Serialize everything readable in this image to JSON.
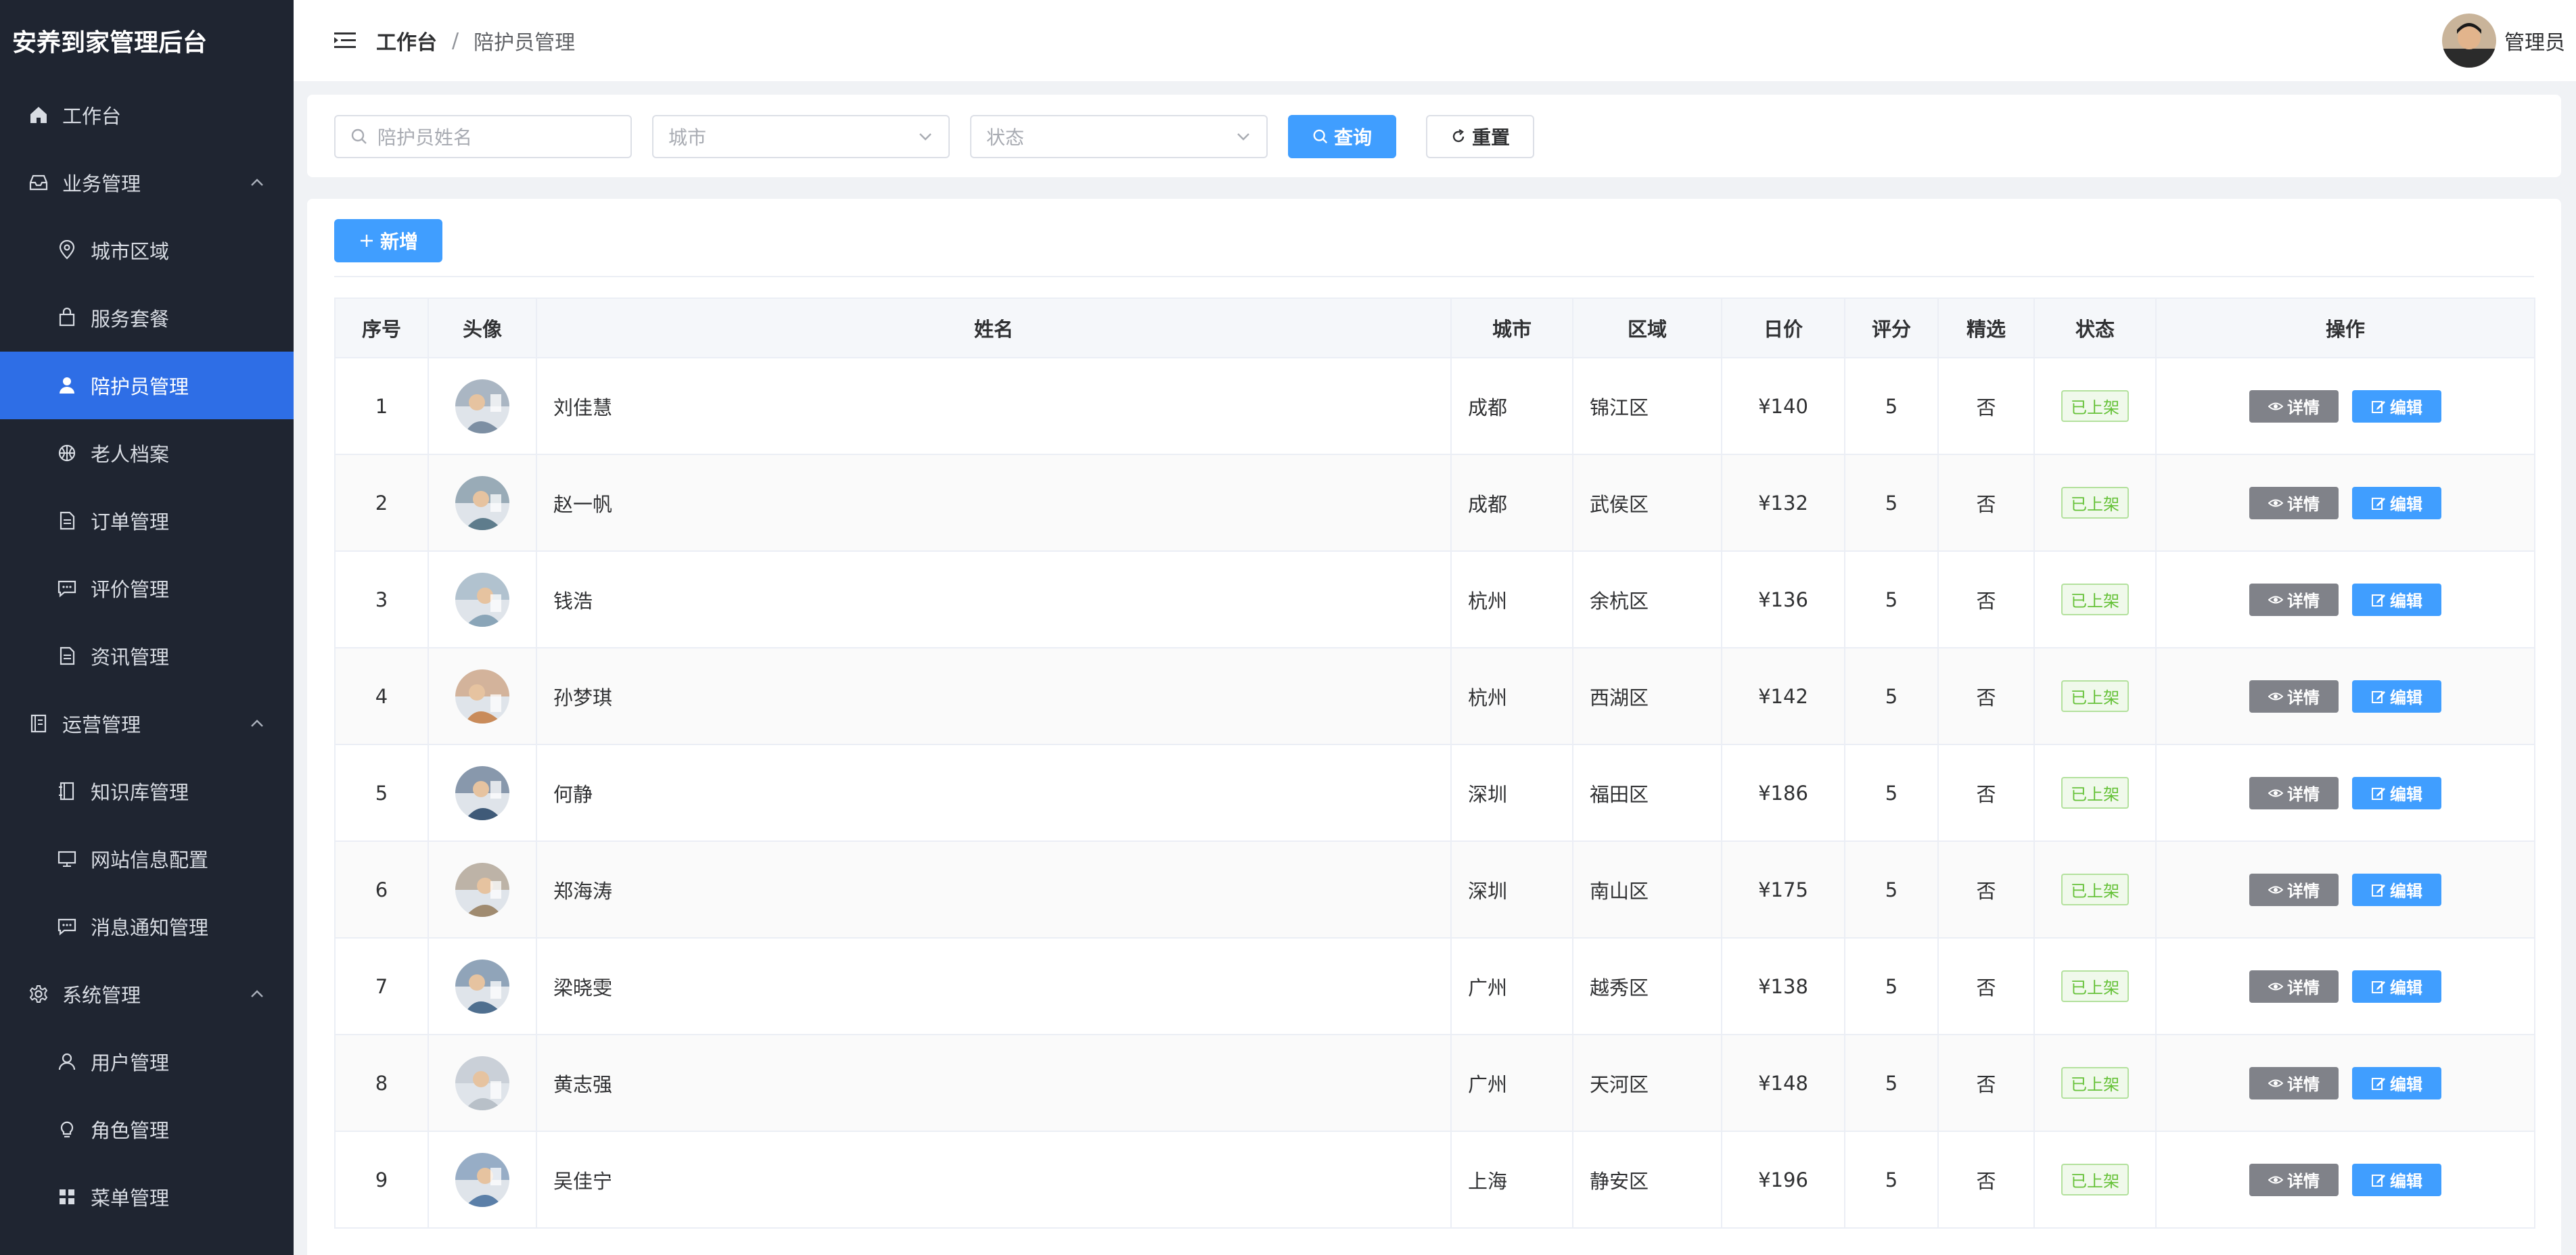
{
  "brand": "安养到家管理后台",
  "sidebar": {
    "items": [
      {
        "label": "工作台",
        "icon": "home-icon",
        "level": "top"
      },
      {
        "label": "业务管理",
        "icon": "inbox-icon",
        "level": "top",
        "expanded": true
      },
      {
        "label": "城市区域",
        "icon": "location-icon",
        "level": "sub"
      },
      {
        "label": "服务套餐",
        "icon": "bag-icon",
        "level": "sub"
      },
      {
        "label": "陪护员管理",
        "icon": "user-icon",
        "level": "sub",
        "active": true
      },
      {
        "label": "老人档案",
        "icon": "basketball-icon",
        "level": "sub"
      },
      {
        "label": "订单管理",
        "icon": "document-icon",
        "level": "sub"
      },
      {
        "label": "评价管理",
        "icon": "chat-icon",
        "level": "sub"
      },
      {
        "label": "资讯管理",
        "icon": "document-icon",
        "level": "sub"
      },
      {
        "label": "运营管理",
        "icon": "tickets-icon",
        "level": "top",
        "expanded": true
      },
      {
        "label": "知识库管理",
        "icon": "notebook-icon",
        "level": "sub"
      },
      {
        "label": "网站信息配置",
        "icon": "monitor-icon",
        "level": "sub"
      },
      {
        "label": "消息通知管理",
        "icon": "chat-icon",
        "level": "sub"
      },
      {
        "label": "系统管理",
        "icon": "gear-icon",
        "level": "top",
        "expanded": true
      },
      {
        "label": "用户管理",
        "icon": "user-outline-icon",
        "level": "sub"
      },
      {
        "label": "角色管理",
        "icon": "bulb-icon",
        "level": "sub"
      },
      {
        "label": "菜单管理",
        "icon": "grid-icon",
        "level": "sub"
      }
    ]
  },
  "header": {
    "breadcrumb_root": "工作台",
    "breadcrumb_separator": "/",
    "breadcrumb_current": "陪护员管理",
    "user_name": "管理员"
  },
  "filter": {
    "name_placeholder": "陪护员姓名",
    "city_placeholder": "城市",
    "status_placeholder": "状态",
    "search_label": "查询",
    "reset_label": "重置"
  },
  "toolbar": {
    "add_label": "新增"
  },
  "table": {
    "headers": [
      "序号",
      "头像",
      "姓名",
      "城市",
      "区域",
      "日价",
      "评分",
      "精选",
      "状态",
      "操作"
    ],
    "detail_label": "详情",
    "edit_label": "编辑",
    "rows": [
      {
        "no": "1",
        "name": "刘佳慧",
        "city": "成都",
        "district": "锦江区",
        "price": "¥140",
        "rating": "5",
        "featured": "否",
        "status": "已上架"
      },
      {
        "no": "2",
        "name": "赵一帆",
        "city": "成都",
        "district": "武侯区",
        "price": "¥132",
        "rating": "5",
        "featured": "否",
        "status": "已上架"
      },
      {
        "no": "3",
        "name": "钱浩",
        "city": "杭州",
        "district": "余杭区",
        "price": "¥136",
        "rating": "5",
        "featured": "否",
        "status": "已上架"
      },
      {
        "no": "4",
        "name": "孙梦琪",
        "city": "杭州",
        "district": "西湖区",
        "price": "¥142",
        "rating": "5",
        "featured": "否",
        "status": "已上架"
      },
      {
        "no": "5",
        "name": "何静",
        "city": "深圳",
        "district": "福田区",
        "price": "¥186",
        "rating": "5",
        "featured": "否",
        "status": "已上架"
      },
      {
        "no": "6",
        "name": "郑海涛",
        "city": "深圳",
        "district": "南山区",
        "price": "¥175",
        "rating": "5",
        "featured": "否",
        "status": "已上架"
      },
      {
        "no": "7",
        "name": "梁晓雯",
        "city": "广州",
        "district": "越秀区",
        "price": "¥138",
        "rating": "5",
        "featured": "否",
        "status": "已上架"
      },
      {
        "no": "8",
        "name": "黄志强",
        "city": "广州",
        "district": "天河区",
        "price": "¥148",
        "rating": "5",
        "featured": "否",
        "status": "已上架"
      },
      {
        "no": "9",
        "name": "吴佳宁",
        "city": "上海",
        "district": "静安区",
        "price": "¥196",
        "rating": "5",
        "featured": "否",
        "status": "已上架"
      }
    ]
  },
  "colors": {
    "sidebar_bg": "#1f2531",
    "active_bg": "#2e6ee6",
    "primary": "#409eff",
    "success": "#67c23a"
  }
}
